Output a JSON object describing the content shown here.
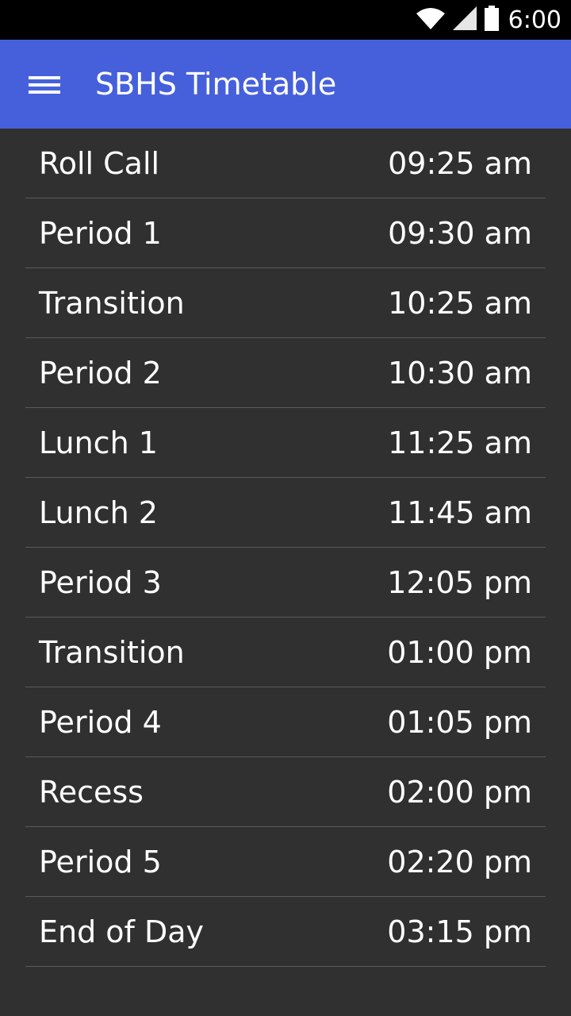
{
  "status_bar": {
    "icons": [
      "wifi-icon",
      "signal-icon",
      "battery-icon"
    ],
    "time": "6:00"
  },
  "app_bar": {
    "title": "SBHS Timetable",
    "menu_icon": "menu-icon",
    "background": "#4660dc"
  },
  "timetable": [
    {
      "name": "Roll Call",
      "time": "09:25 am"
    },
    {
      "name": "Period 1",
      "time": "09:30 am"
    },
    {
      "name": "Transition",
      "time": "10:25 am"
    },
    {
      "name": "Period 2",
      "time": "10:30 am"
    },
    {
      "name": "Lunch 1",
      "time": "11:25 am"
    },
    {
      "name": "Lunch 2",
      "time": "11:45 am"
    },
    {
      "name": "Period 3",
      "time": "12:05 pm"
    },
    {
      "name": "Transition",
      "time": "01:00 pm"
    },
    {
      "name": "Period 4",
      "time": "01:05 pm"
    },
    {
      "name": "Recess",
      "time": "02:00 pm"
    },
    {
      "name": "Period 5",
      "time": "02:20 pm"
    },
    {
      "name": "End of Day",
      "time": "03:15 pm"
    }
  ],
  "colors": {
    "background": "#303030",
    "divider": "#5a5a5a",
    "text": "#ffffff"
  }
}
